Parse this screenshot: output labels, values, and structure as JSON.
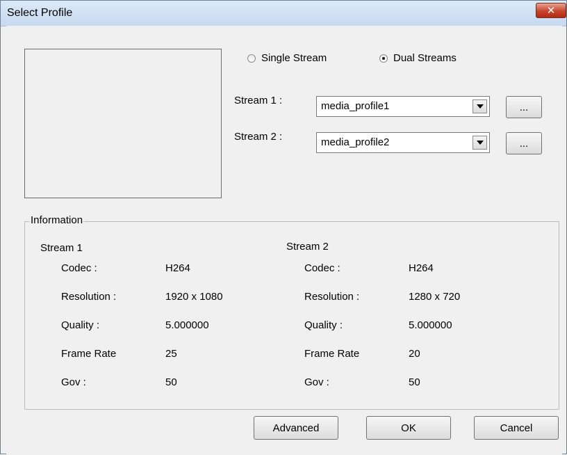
{
  "window": {
    "title": "Select Profile",
    "close_glyph": "✕"
  },
  "stream_mode": {
    "single_label": "Single Stream",
    "dual_label": "Dual Streams",
    "selected": "dual"
  },
  "streams": [
    {
      "label": "Stream 1 :",
      "selected_profile": "media_profile1",
      "browse_label": "..."
    },
    {
      "label": "Stream 2 :",
      "selected_profile": "media_profile2",
      "browse_label": "..."
    }
  ],
  "information": {
    "group_title": "Information",
    "columns": [
      {
        "heading": "Stream 1",
        "rows": [
          {
            "label": "Codec :",
            "value": "H264"
          },
          {
            "label": "Resolution :",
            "value": "1920 x 1080"
          },
          {
            "label": "Quality :",
            "value": "5.000000"
          },
          {
            "label": "Frame Rate",
            "value": "25"
          },
          {
            "label": "Gov :",
            "value": "50"
          }
        ]
      },
      {
        "heading": "Stream 2",
        "rows": [
          {
            "label": "Codec :",
            "value": "H264"
          },
          {
            "label": "Resolution :",
            "value": "1280 x 720"
          },
          {
            "label": "Quality :",
            "value": "5.000000"
          },
          {
            "label": "Frame Rate",
            "value": "20"
          },
          {
            "label": "Gov :",
            "value": "50"
          }
        ]
      }
    ]
  },
  "buttons": {
    "advanced": "Advanced",
    "ok": "OK",
    "cancel": "Cancel"
  }
}
